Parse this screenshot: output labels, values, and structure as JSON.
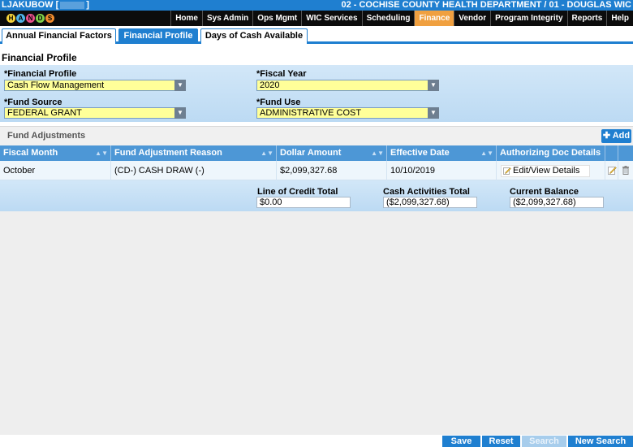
{
  "header": {
    "user": "LJAKUBOW [",
    "user_end": "]",
    "department": "02 - COCHISE COUNTY HEALTH DEPARTMENT / 01 - DOUGLAS WIC"
  },
  "nav": {
    "logo_letters": [
      "H",
      "A",
      "N",
      "D",
      "S"
    ],
    "items": [
      "Home",
      "Sys Admin",
      "Ops Mgmt",
      "WIC Services",
      "Scheduling",
      "Finance",
      "Vendor",
      "Program Integrity",
      "Reports",
      "Help"
    ],
    "active": "Finance"
  },
  "tabs": [
    "Annual Financial Factors",
    "Financial Profile",
    "Days of Cash Available"
  ],
  "page_title": "Financial Profile",
  "form": {
    "financial_profile_label": "*Financial Profile",
    "financial_profile_value": "Cash Flow Management",
    "fiscal_year_label": "*Fiscal Year",
    "fiscal_year_value": "2020",
    "fund_source_label": "*Fund Source",
    "fund_source_value": "FEDERAL GRANT",
    "fund_use_label": "*Fund Use",
    "fund_use_value": "ADMINISTRATIVE COST"
  },
  "fund_adjustments": {
    "title": "Fund Adjustments",
    "add_label": "Add",
    "columns": [
      "Fiscal Month",
      "Fund Adjustment Reason",
      "Dollar Amount",
      "Effective Date",
      "Authorizing Doc Details"
    ],
    "rows": [
      {
        "fiscal_month": "October",
        "reason": "(CD-) CASH DRAW (-)",
        "amount": "$2,099,327.68",
        "effective_date": "10/10/2019",
        "doc_link": "Edit/View Details"
      }
    ]
  },
  "totals": {
    "line_of_credit_label": "Line of Credit Total",
    "line_of_credit_value": "$0.00",
    "cash_activities_label": "Cash Activities Total",
    "cash_activities_value": "($2,099,327.68)",
    "current_balance_label": "Current Balance",
    "current_balance_value": "($2,099,327.68)"
  },
  "buttons": {
    "save": "Save",
    "reset": "Reset",
    "search": "Search",
    "new_search": "New Search"
  },
  "colors": {
    "primary": "#1f7fd0",
    "active_menu": "#f0a040",
    "required_field": "#ffff99"
  }
}
